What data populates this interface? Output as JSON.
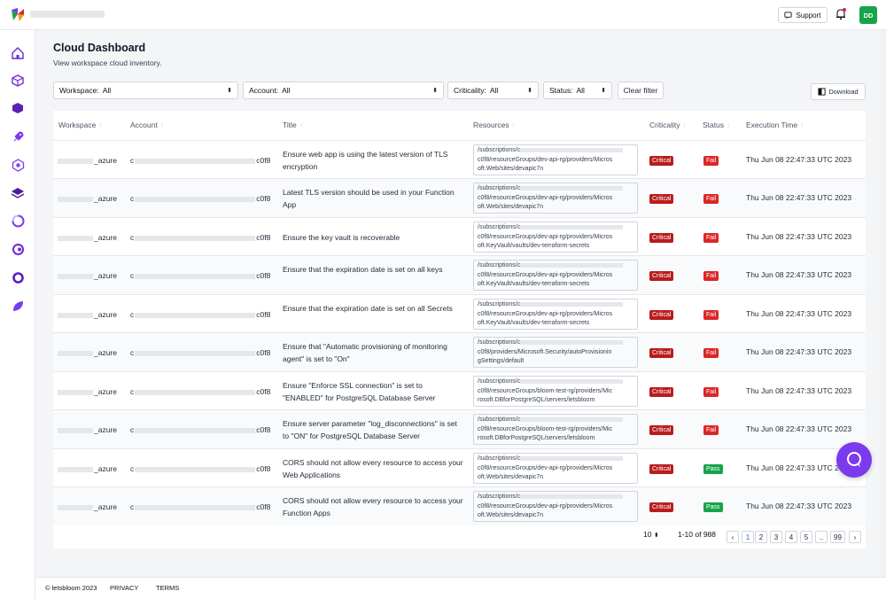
{
  "header": {
    "support_label": "Support",
    "avatar_initials": "DD"
  },
  "sidebar": {
    "icons": [
      "home-icon",
      "cube-icon",
      "hexagon-icon",
      "rocket-icon",
      "target-icon",
      "layers-icon",
      "spinner-icon",
      "orbit-icon",
      "ring-icon",
      "leaf-icon"
    ]
  },
  "page": {
    "title": "Cloud Dashboard",
    "subtitle": "View workspace cloud inventory."
  },
  "filters": {
    "workspace": {
      "label": "Workspace:",
      "value": "All"
    },
    "account": {
      "label": "Account:",
      "value": "All"
    },
    "criticality": {
      "label": "Criticality:",
      "value": "All"
    },
    "status": {
      "label": "Status:",
      "value": "All"
    },
    "clear_label": "Clear filter",
    "download_label": "Download"
  },
  "table": {
    "columns": [
      "Workspace",
      "Account",
      "Title",
      "Resources",
      "Criticality",
      "Status",
      "Execution Time"
    ],
    "rows": [
      {
        "workspace": "_azure",
        "account_prefix": "c",
        "account_suffix": "c0f8",
        "title": "Ensure web app is using the latest version of TLS encryption",
        "res1": "/subscriptions/c",
        "res2": "c0f8/resourceGroups/dev-api-rg/providers/Micros",
        "res3": "oft.Web/sites/devapic7n",
        "criticality": "Critical",
        "status": "Fail",
        "time": "Thu Jun 08 22:47:33 UTC 2023"
      },
      {
        "workspace": "_azure",
        "account_prefix": "c",
        "account_suffix": "c0f8",
        "title": "Latest TLS version should be used in your Function App",
        "res1": "/subscriptions/c",
        "res2": "c0f8/resourceGroups/dev-api-rg/providers/Micros",
        "res3": "oft.Web/sites/devapic7n",
        "criticality": "Critical",
        "status": "Fail",
        "time": "Thu Jun 08 22:47:33 UTC 2023"
      },
      {
        "workspace": "_azure",
        "account_prefix": "c",
        "account_suffix": "c0f8",
        "title": "Ensure the key vault is recoverable",
        "res1": "/subscriptions/c",
        "res2": "c0f8/resourceGroups/dev-api-rg/providers/Micros",
        "res3": "oft.KeyVault/vaults/dev-terraform-secrets",
        "criticality": "Critical",
        "status": "Fail",
        "time": "Thu Jun 08 22:47:33 UTC 2023"
      },
      {
        "workspace": "_azure",
        "account_prefix": "c",
        "account_suffix": "c0f8",
        "title": "Ensure that the expiration date is set on all keys",
        "res1": "/subscriptions/c",
        "res2": "c0f8/resourceGroups/dev-api-rg/providers/Micros",
        "res3": "oft.KeyVault/vaults/dev-terraform-secrets",
        "criticality": "Critical",
        "status": "Fail",
        "time": "Thu Jun 08 22:47:33 UTC 2023"
      },
      {
        "workspace": "_azure",
        "account_prefix": "c",
        "account_suffix": "c0f8",
        "title": "Ensure that the expiration date is set on all Secrets",
        "res1": "/subscriptions/c",
        "res2": "c0f8/resourceGroups/dev-api-rg/providers/Micros",
        "res3": "oft.KeyVault/vaults/dev-terraform-secrets",
        "criticality": "Critical",
        "status": "Fail",
        "time": "Thu Jun 08 22:47:33 UTC 2023"
      },
      {
        "workspace": "_azure",
        "account_prefix": "c",
        "account_suffix": "c0f8",
        "title": "Ensure that \"Automatic provisioning of monitoring agent\" is set to \"On\"",
        "res1": "/subscriptions/c",
        "res2": "c0f8/providers/Microsoft.Security/autoProvisionin",
        "res3": "gSettings/default",
        "criticality": "Critical",
        "status": "Fail",
        "time": "Thu Jun 08 22:47:33 UTC 2023"
      },
      {
        "workspace": "_azure",
        "account_prefix": "c",
        "account_suffix": "c0f8",
        "title": "Ensure \"Enforce SSL connection\" is set to \"ENABLED\" for PostgreSQL Database Server",
        "res1": "/subscriptions/c",
        "res2": "c0f8/resourceGroups/bloom-test-rg/providers/Mic",
        "res3": "rosoft.DBforPostgreSQL/servers/letsbloom",
        "criticality": "Critical",
        "status": "Fail",
        "time": "Thu Jun 08 22:47:33 UTC 2023"
      },
      {
        "workspace": "_azure",
        "account_prefix": "c",
        "account_suffix": "c0f8",
        "title": "Ensure server parameter \"log_disconnections\" is set to \"ON\" for PostgreSQL Database Server",
        "res1": "/subscriptions/c",
        "res2": "c0f8/resourceGroups/bloom-test-rg/providers/Mic",
        "res3": "rosoft.DBforPostgreSQL/servers/letsbloom",
        "criticality": "Critical",
        "status": "Fail",
        "time": "Thu Jun 08 22:47:33 UTC 2023"
      },
      {
        "workspace": "_azure",
        "account_prefix": "c",
        "account_suffix": "c0f8",
        "title": "CORS should not allow every resource to access your Web Applications",
        "res1": "/subscriptions/c",
        "res2": "c0f8/resourceGroups/dev-api-rg/providers/Micros",
        "res3": "oft.Web/sites/devapic7n",
        "criticality": "Critical",
        "status": "Pass",
        "time": "Thu Jun 08 22:47:33 UTC 2023"
      },
      {
        "workspace": "_azure",
        "account_prefix": "c",
        "account_suffix": "c0f8",
        "title": "CORS should not allow every resource to access your Function Apps",
        "res1": "/subscriptions/c",
        "res2": "c0f8/resourceGroups/dev-api-rg/providers/Micros",
        "res3": "oft.Web/sites/devapic7n",
        "criticality": "Critical",
        "status": "Pass",
        "time": "Thu Jun 08 22:47:33 UTC 2023"
      }
    ]
  },
  "pagination": {
    "page_size": "10",
    "range": "1-10 of 988",
    "pages": [
      "1",
      "2",
      "3",
      "4",
      "5",
      "..",
      "99"
    ],
    "current": "1"
  },
  "footer": {
    "copyright": "© letsbloom 2023",
    "privacy": "PRIVACY",
    "terms": "TERMS"
  },
  "colors": {
    "critical": "#b91c1c",
    "fail": "#dc2626",
    "pass": "#16a34a",
    "accent": "#7c3aed",
    "avatar": "#16a34a"
  }
}
